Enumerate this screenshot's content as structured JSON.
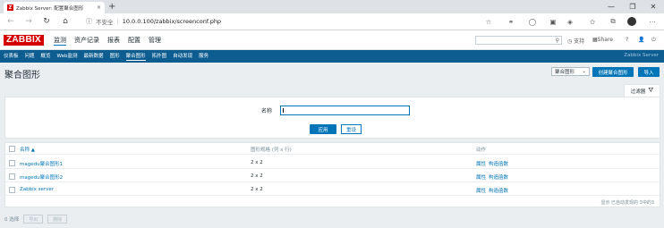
{
  "browser": {
    "tab_title": "Zabbix Server: 配置聚合图形",
    "favicon_letter": "Z",
    "tab_close": "×",
    "new_tab": "+",
    "insecure_label": "不安全",
    "url": "10.0.0.100/zabbix/screenconf.php",
    "window_controls": [
      "—",
      "❐",
      "✕"
    ]
  },
  "zabbix": {
    "logo": "ZABBIX",
    "top_nav": [
      "监测",
      "资产记录",
      "报表",
      "配置",
      "管理"
    ],
    "support": "支持",
    "share": "Share",
    "help": "?",
    "sub_nav": [
      "仪表板",
      "问题",
      "概览",
      "Web监测",
      "最新数据",
      "图形",
      "聚合图形",
      "拓扑图",
      "自动发现",
      "服务"
    ],
    "server_name": "Zabbix Server"
  },
  "page": {
    "title": "聚合图形",
    "select_value": "聚合图形",
    "create_button": "创建聚合图形",
    "import_button": "导入",
    "filter_tab": "过滤器"
  },
  "filter": {
    "name_label": "名称",
    "name_value": "",
    "apply": "应用",
    "reset": "重设"
  },
  "table": {
    "headers": {
      "name": "名称 ▲",
      "dimension": "图形规格 (列 x 行)",
      "actions": "动作"
    },
    "rows": [
      {
        "name": "magedu聚合图形1",
        "dimension": "2 x 2",
        "action1": "属性",
        "action2": "构造函数"
      },
      {
        "name": "magedu聚合图形2",
        "dimension": "2 x 2",
        "action1": "属性",
        "action2": "构造函数"
      },
      {
        "name": "Zabbix server",
        "dimension": "2 x 2",
        "action1": "属性",
        "action2": "构造函数"
      }
    ],
    "footer": "显示 已自动发现的 3中的3"
  },
  "footer_actions": {
    "selected": "0 选择",
    "export": "导出",
    "delete": "删除"
  }
}
